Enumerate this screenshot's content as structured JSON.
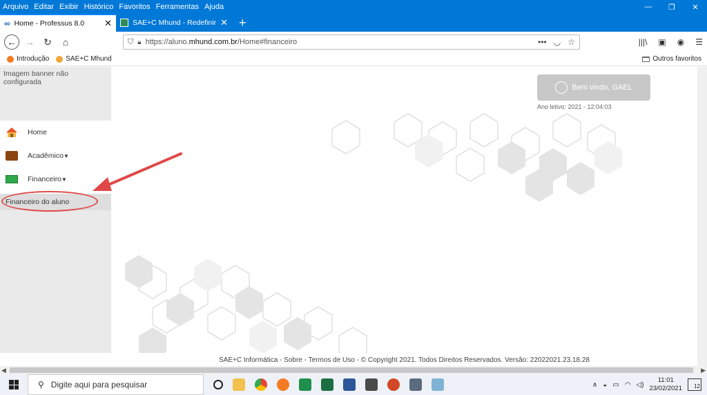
{
  "menubar": {
    "items": [
      "Arquivo",
      "Editar",
      "Exibir",
      "Histórico",
      "Favoritos",
      "Ferramentas",
      "Ajuda"
    ]
  },
  "tabs": [
    {
      "label": "Home - Professus 8.0",
      "active": true
    },
    {
      "label": "SAE+C Mhund - Redefinir Senh",
      "active": false
    }
  ],
  "navbar": {
    "url_prefix": "https://aluno.",
    "url_domain": "mhund.com.br",
    "url_path": "/Home#financeiro",
    "more": "•••"
  },
  "bookmarks": {
    "items": [
      "Introdução",
      "SAE+C Mhund"
    ],
    "other": "Outros favoritos"
  },
  "sidebar": {
    "banner_text": "Imagem banner não configurada",
    "menu": [
      {
        "label": "Home",
        "icon": "home-icon"
      },
      {
        "label": "Acadêmico",
        "icon": "briefcase-icon"
      },
      {
        "label": "Financeiro",
        "icon": "money-icon"
      }
    ],
    "sub_item": "Financeiro do aluno"
  },
  "content": {
    "welcome": "Bem vindo, GAEL",
    "year_text": "Ano letivo: 2021 - 12:04:03"
  },
  "footer": {
    "text": "SAE+C Informática - Sobre - Termos de Uso - © Copyright 2021. Todos Direitos Reservados. Versão: 22022021.23.18.28"
  },
  "taskbar": {
    "search_placeholder": "Digite aqui para pesquisar",
    "time": "11:01",
    "date": "23/02/2021",
    "notifications": "12"
  },
  "colors": {
    "accent": "#0078d7",
    "annotation": "#e04848",
    "sidebar_bg": "#eaeaea"
  }
}
